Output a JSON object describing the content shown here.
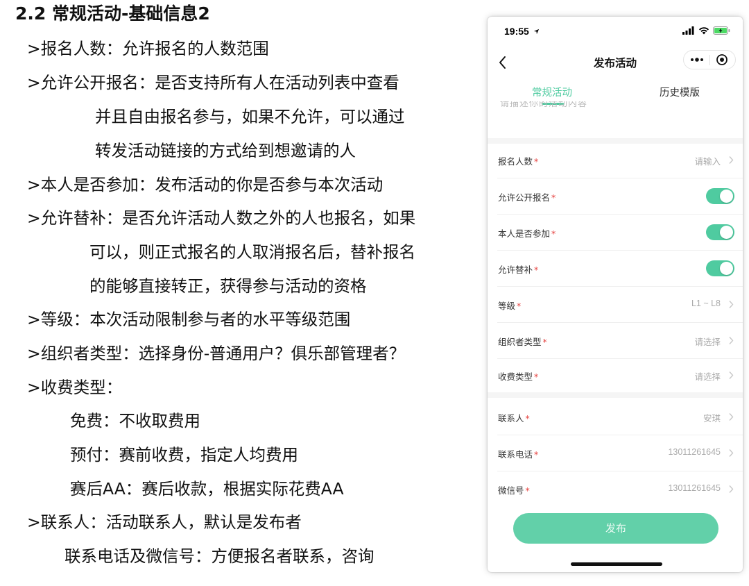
{
  "doc": {
    "title": "2.2 常规活动-基础信息2",
    "lines": [
      ">报名人数：允许报名的人数范围",
      ">允许公开报名：是否支持所有人在活动列表中查看",
      "并且自由报名参与，如果不允许，可以通过",
      "转发活动链接的方式给到想邀请的人",
      ">本人是否参加：发布活动的你是否参与本次活动",
      ">允许替补：是否允许活动人数之外的人也报名，如果",
      "可以，则正式报名的人取消报名后，替补报名",
      "的能够直接转正，获得参与活动的资格",
      ">等级：本次活动限制参与者的水平等级范围",
      ">组织者类型：选择身份-普通用户？俱乐部管理者？",
      ">收费类型：",
      "免费：不收取费用",
      "预付：赛前收费，指定人均费用",
      "赛后AA：赛后收款，根据实际花费AA",
      ">联系人：活动联系人，默认是发布者",
      "联系电话及微信号：方便报名者联系，咨询"
    ]
  },
  "phone": {
    "status_time": "19:55",
    "nav_title": "发布活动",
    "tabs": [
      "常规活动",
      "历史模版"
    ],
    "partial_text": "请描述你的活动内容",
    "required_mark": "*",
    "fields": [
      {
        "label": "报名人数",
        "value": "请输入"
      },
      {
        "label": "允许公开报名",
        "toggle": true
      },
      {
        "label": "本人是否参加",
        "toggle": true
      },
      {
        "label": "允许替补",
        "toggle": true
      },
      {
        "label": "等级",
        "value": "L1 ~ L8"
      },
      {
        "label": "组织者类型",
        "value": "请选择"
      },
      {
        "label": "收费类型",
        "value": "请选择"
      },
      {
        "label": "联系人",
        "value": "安琪"
      },
      {
        "label": "联系电话",
        "value": "13011261645"
      },
      {
        "label": "微信号",
        "value": "13011261645"
      }
    ],
    "publish_label": "发布",
    "colors": {
      "accent": "#4fcba0",
      "button": "#62d0a9",
      "required": "#e64340"
    }
  }
}
